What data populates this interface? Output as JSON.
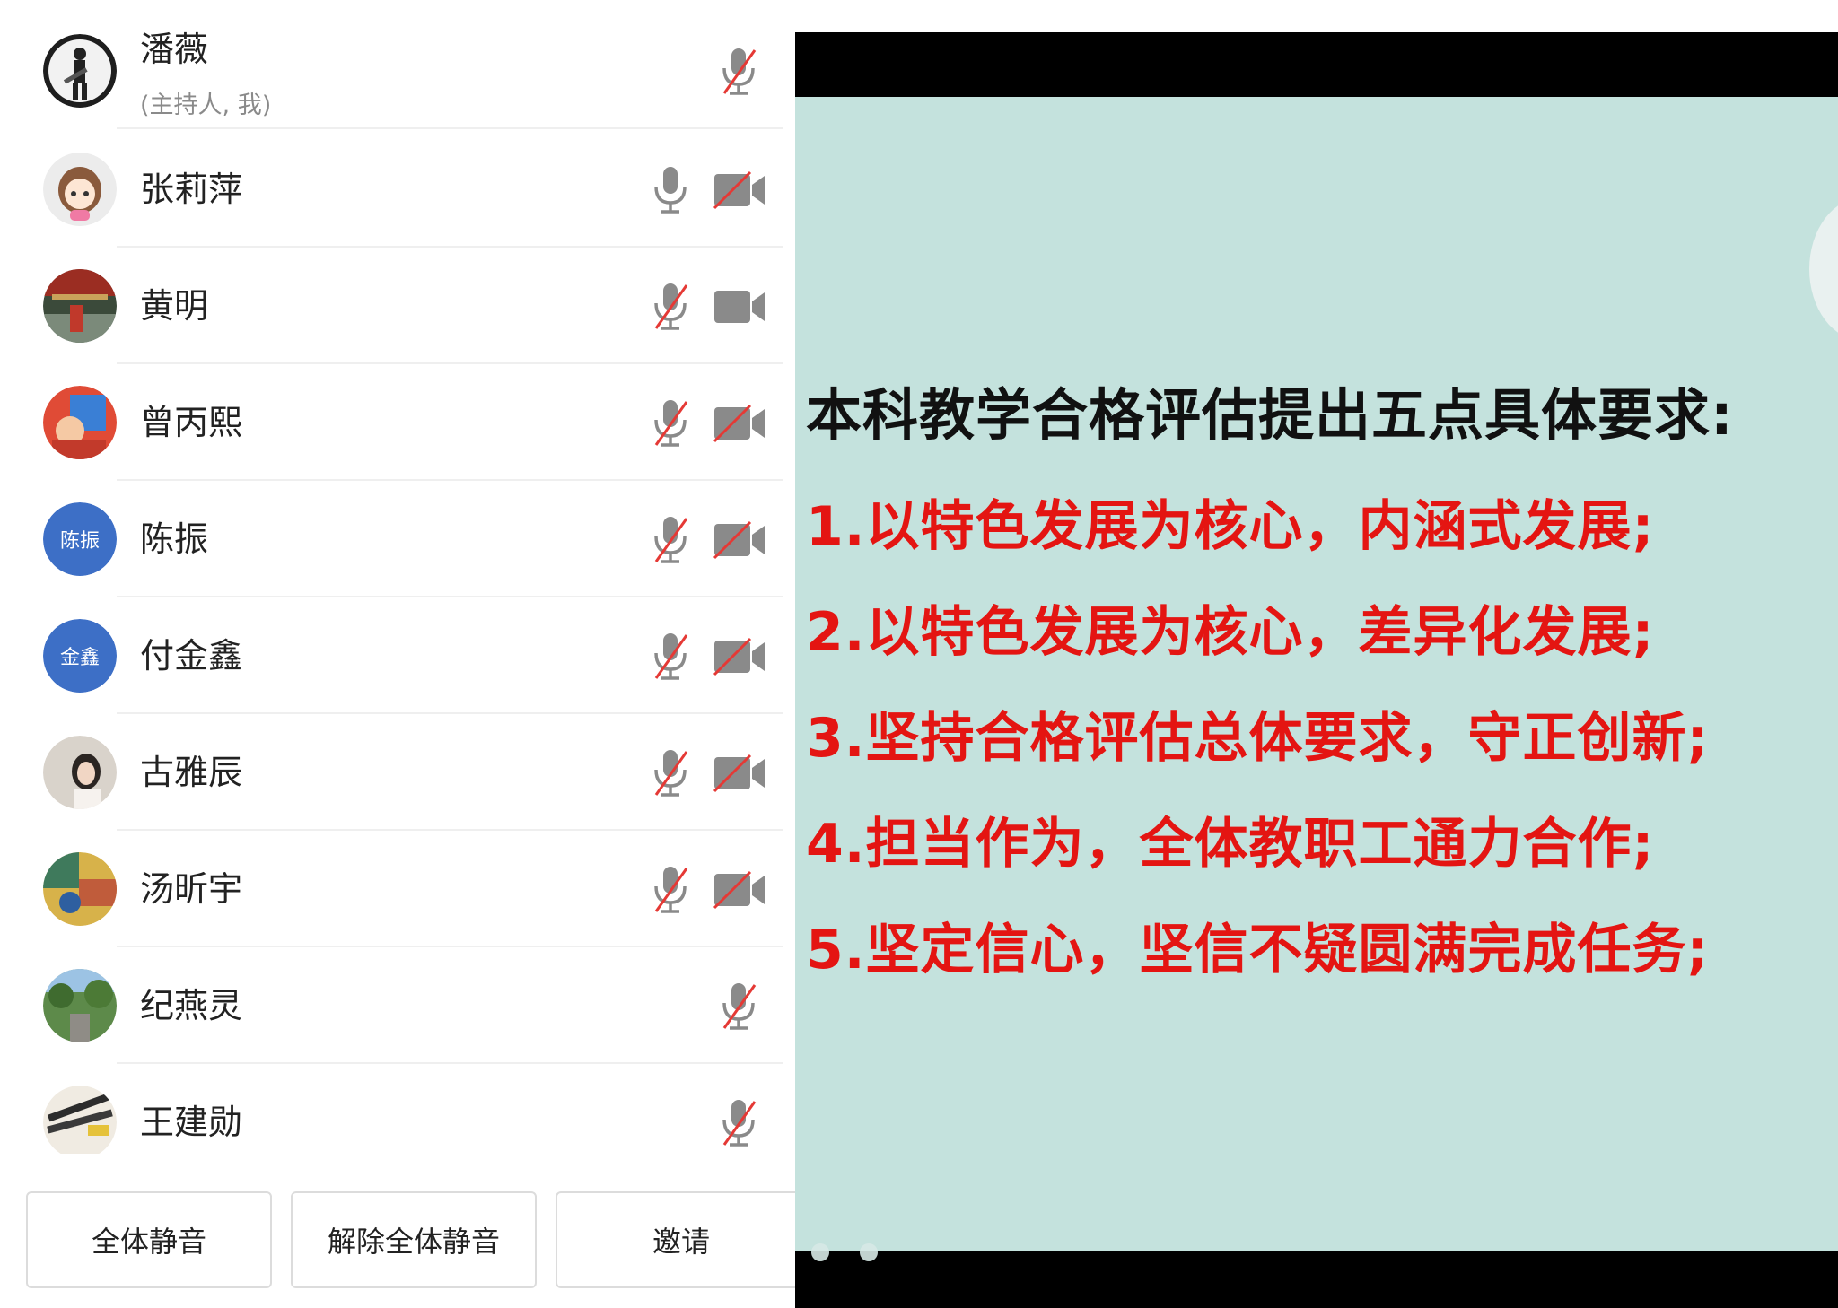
{
  "participants": [
    {
      "name": "潘薇",
      "role": "(主持人, 我)",
      "avatar": "photo-man-guitar",
      "mic": "muted",
      "camera": "none"
    },
    {
      "name": "张莉萍",
      "avatar": "cartoon-girl",
      "mic": "on",
      "camera": "off"
    },
    {
      "name": "黄明",
      "avatar": "photo-temple",
      "mic": "muted",
      "camera": "on"
    },
    {
      "name": "曾丙熙",
      "avatar": "photo-red",
      "mic": "muted",
      "camera": "off"
    },
    {
      "name": "陈振",
      "avatar_text": "陈振",
      "mic": "muted",
      "camera": "off"
    },
    {
      "name": "付金鑫",
      "avatar_text": "金鑫",
      "mic": "muted",
      "camera": "off"
    },
    {
      "name": "古雅辰",
      "avatar": "photo-woman",
      "mic": "muted",
      "camera": "off"
    },
    {
      "name": "汤昕宇",
      "avatar": "photo-illustration",
      "mic": "muted",
      "camera": "off"
    },
    {
      "name": "纪燕灵",
      "avatar": "photo-garden",
      "mic": "muted",
      "camera": "none"
    },
    {
      "name": "王建勋",
      "avatar": "photo-objects",
      "mic": "muted",
      "camera": "none"
    }
  ],
  "actions": {
    "mute_all": "全体静音",
    "unmute_all": "解除全体静音",
    "invite": "邀请"
  },
  "slide": {
    "title": "本科教学合格评估提出五点具体要求:",
    "points": [
      "1.以特色发展为核心，内涵式发展;",
      "2.以特色发展为核心，差异化发展;",
      "3.坚持合格评估总体要求，守正创新;",
      "4.担当作为，全体教职工通力合作;",
      "5.坚定信心，坚信不疑圆满完成任务;"
    ],
    "background": "#c4e2dd",
    "point_color": "#e41512",
    "page_dots": 2
  },
  "colors": {
    "muted_slash": "#e53935",
    "icon_gray": "#8a8a8a",
    "avatar_blue": "#3d6fc6"
  }
}
